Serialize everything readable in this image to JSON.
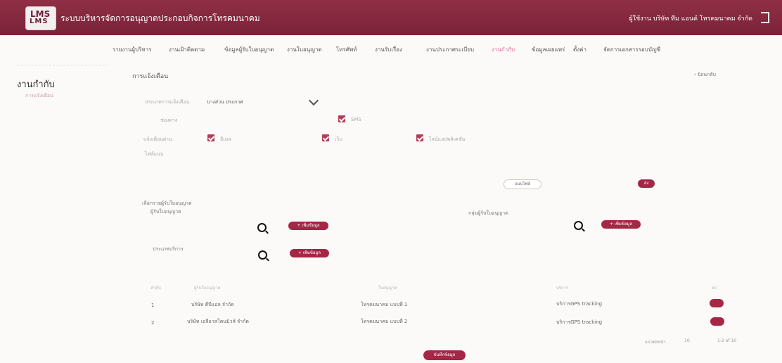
{
  "header": {
    "logo_text": "LMS",
    "logo_mark": "LMS",
    "app_title": "ระบบบริหารจัดการอนุญาตประกอบกิจการโทรคมนาคม",
    "user_text": "ผู้ใช้งาน บริษัท ทีม แอนด์ โทรคมนาคม จำกัด"
  },
  "nav": {
    "items": [
      {
        "label": "รายงานผู้บริหาร"
      },
      {
        "label": "งานเฝ้าติดตาม"
      },
      {
        "label": "ข้อมูลผู้รับใบอนุญาต"
      },
      {
        "label": "งานใบอนุญาต"
      },
      {
        "label": "โทรศัพท์"
      },
      {
        "label": "งานรับเรื่อง"
      },
      {
        "label": "งานประกาศระเบียบ"
      },
      {
        "label": "งานกำกับ",
        "active": true
      },
      {
        "label": "ข้อมูลเผยแพร่"
      },
      {
        "label": "ตั้งค่า"
      },
      {
        "label": "จัดการเอกสารรอบบัญชี"
      }
    ]
  },
  "sidebar": {
    "title": "งานกำกับ",
    "link": "การแจ้งเตือน"
  },
  "main": {
    "page_title": "การแจ้งเตือน",
    "back_link": "ย้อนกลับ",
    "form": {
      "type_label": "ประเภทการแจ้งเตือน",
      "type_value": "บางส่วน ประกาศ",
      "channel_label": "ช่องทาง",
      "sms_label": "SMS",
      "notify_label": "แจ้งเตือนผ่าน",
      "email_label": "อีเมล",
      "web_label": "เว็บ",
      "line_label": "ไลน์แอปพลิเคชัน",
      "file_label": "ไฟล์แนบ",
      "upload_label": "แนบไฟล์",
      "send_label": "ส่ง"
    },
    "sections": {
      "licensee_title": "เลือกรายผู้รับใบอนุญาต",
      "licensee_label": "ผู้รับใบอนุญาต",
      "group_label": "กลุ่มผู้รับใบอนุญาต",
      "service_label": "ประเภทบริการ",
      "add_label": "+ เพิ่มข้อมูล"
    },
    "table": {
      "headers": [
        "ลำดับ",
        "ผู้รับใบอนุญาต",
        "ใบอนุญาต",
        "บริการ",
        "ลบ"
      ],
      "rows": [
        {
          "no": "1",
          "company": "บริษัท ดีบีแอล จำกัด",
          "license": "โทรคมนาคม แบบที่ 1",
          "service": "บริการGPS tracking"
        },
        {
          "no": "2",
          "company": "บริษัท เอลีอาสโตนมิวส์ จำกัด",
          "license": "โทรคมนาคม แบบที่ 2",
          "service": "บริการGPS tracking"
        }
      ]
    },
    "pagination": {
      "rows_text": "แถวต่อหน้า",
      "page_text": "10",
      "range_text": "1-2 of 10"
    },
    "bottom_button": "บันทึกข้อมูล"
  },
  "colors": {
    "primary": "#8f2f45",
    "accent": "#a52645",
    "active_nav": "#d56a98"
  },
  "icons": [
    "search-icon",
    "chevron-down-icon",
    "logout-icon",
    "back-icon"
  ]
}
